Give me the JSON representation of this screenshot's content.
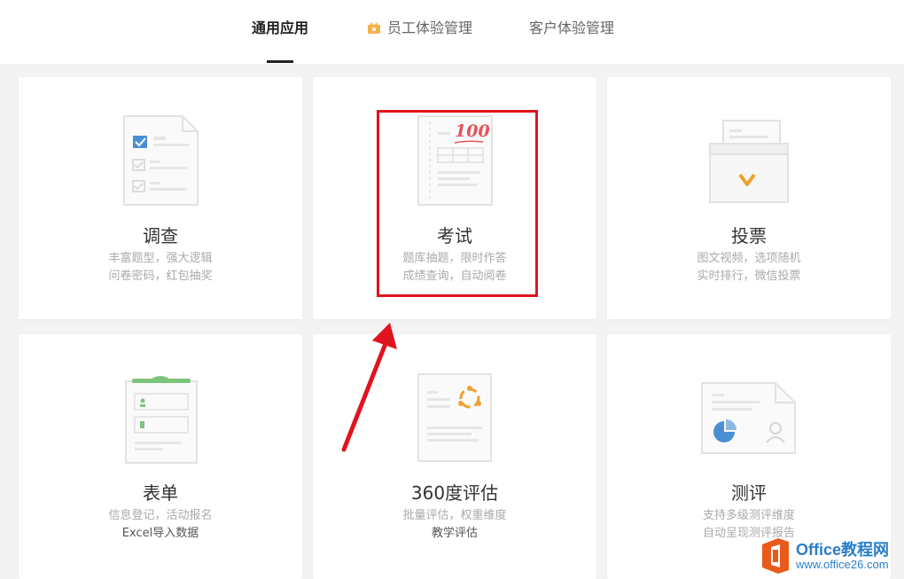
{
  "tabs": [
    {
      "label": "通用应用",
      "active": true
    },
    {
      "label": "员工体验管理",
      "icon": "crown-badge-icon",
      "active": false
    },
    {
      "label": "客户体验管理",
      "active": false
    }
  ],
  "cards": [
    {
      "title": "调查",
      "desc1": "丰富题型，强大逻辑",
      "desc2": "问卷密码，红包抽奖",
      "icon": "survey-icon"
    },
    {
      "title": "考试",
      "desc1": "题库抽题，限时作答",
      "desc2": "成绩查询，自动阅卷",
      "icon": "exam-icon",
      "score_text": "100"
    },
    {
      "title": "投票",
      "desc1": "图文视频，选项随机",
      "desc2": "实时排行，微信投票",
      "icon": "vote-icon"
    },
    {
      "title": "表单",
      "desc1": "信息登记，活动报名",
      "desc2": "Excel导入数据",
      "icon": "form-icon"
    },
    {
      "title": "360度评估",
      "desc1": "批量评估，权重维度",
      "desc2": "教学评估",
      "icon": "evaluation-360-icon"
    },
    {
      "title": "测评",
      "desc1": "支持多级测评维度",
      "desc2": "自动呈现测评报告",
      "icon": "assessment-icon"
    }
  ],
  "watermark": {
    "line1": "Office教程网",
    "line2": "www.office26.com"
  },
  "colors": {
    "highlight": "#e0141e",
    "watermark": "#2a7ec9",
    "accent_blue": "#4a8fd4",
    "accent_orange": "#f0a030",
    "accent_green": "#7cc47a"
  }
}
